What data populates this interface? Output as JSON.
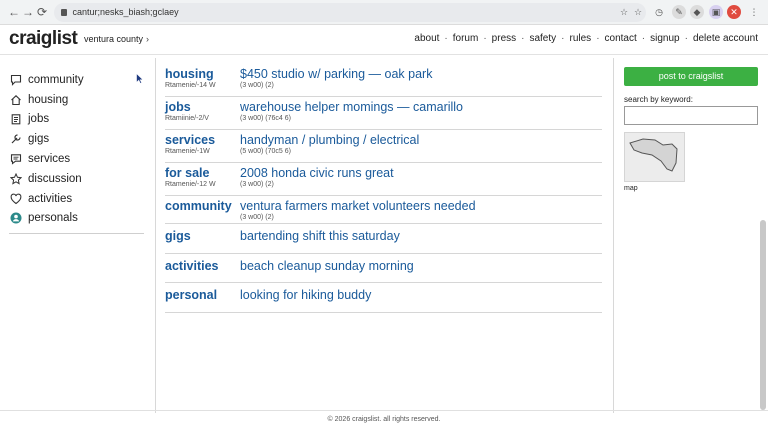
{
  "browser": {
    "url": "cantur;nesks_biash;gclaey",
    "back_icon": "arrow-left-icon",
    "forward_icon": "arrow-right-icon",
    "reload_icon": "reload-icon"
  },
  "header": {
    "logo": "craiglist",
    "region": "ventura county",
    "links": [
      "about",
      "forum",
      "press",
      "safety",
      "rules",
      "contact",
      "signup",
      "delete account"
    ]
  },
  "sidebar": {
    "items": [
      {
        "label": "community",
        "icon": "speech-bubble-icon"
      },
      {
        "label": "housing",
        "icon": "house-icon"
      },
      {
        "label": "jobs",
        "icon": "clipboard-icon"
      },
      {
        "label": "gigs",
        "icon": "wrench-icon"
      },
      {
        "label": "services",
        "icon": "chat-icon"
      },
      {
        "label": "discussion",
        "icon": "star-icon"
      },
      {
        "label": "activities",
        "icon": "heart-icon"
      },
      {
        "label": "personals",
        "icon": "person-icon"
      }
    ]
  },
  "listings": [
    {
      "category": "housing",
      "meta": "Rtamenie/-14 W",
      "title": "$450 studio w/ parking — oak park",
      "count": "(3 w00) (2)"
    },
    {
      "category": "jobs",
      "meta": "Rtamiinie/-2/V",
      "title": "warehouse helper momings — camarillo",
      "count": "(3 w00) (76c4 6)"
    },
    {
      "category": "services",
      "meta": "Rtamenie/-1W",
      "title": "handyman / plumbing / electrical",
      "count": "(5 w00) (70c5 6)"
    },
    {
      "category": "for sale",
      "meta": "Rtamenie/-12 W",
      "title": "2008 honda civic runs great",
      "count": "(3 w00) (2)"
    },
    {
      "category": "community",
      "meta": "",
      "title": "ventura farmers market volunteers needed",
      "count": "(3 w00) (2)"
    },
    {
      "category": "gigs",
      "meta": "",
      "title": "bartending shift this saturday",
      "count": ""
    },
    {
      "category": "activities",
      "meta": "",
      "title": "beach cleanup sunday morning",
      "count": ""
    },
    {
      "category": "personal",
      "meta": "",
      "title": "looking for hiking buddy",
      "count": ""
    }
  ],
  "right_panel": {
    "post_button": "post to craigslist",
    "search_label": "search by keyword:",
    "search_value": "",
    "map_label": "map"
  },
  "footer": {
    "text": "© 2026 craigslist. all rights reserved."
  },
  "colors": {
    "link": "#1a5a9a",
    "post_button": "#3cb043"
  }
}
